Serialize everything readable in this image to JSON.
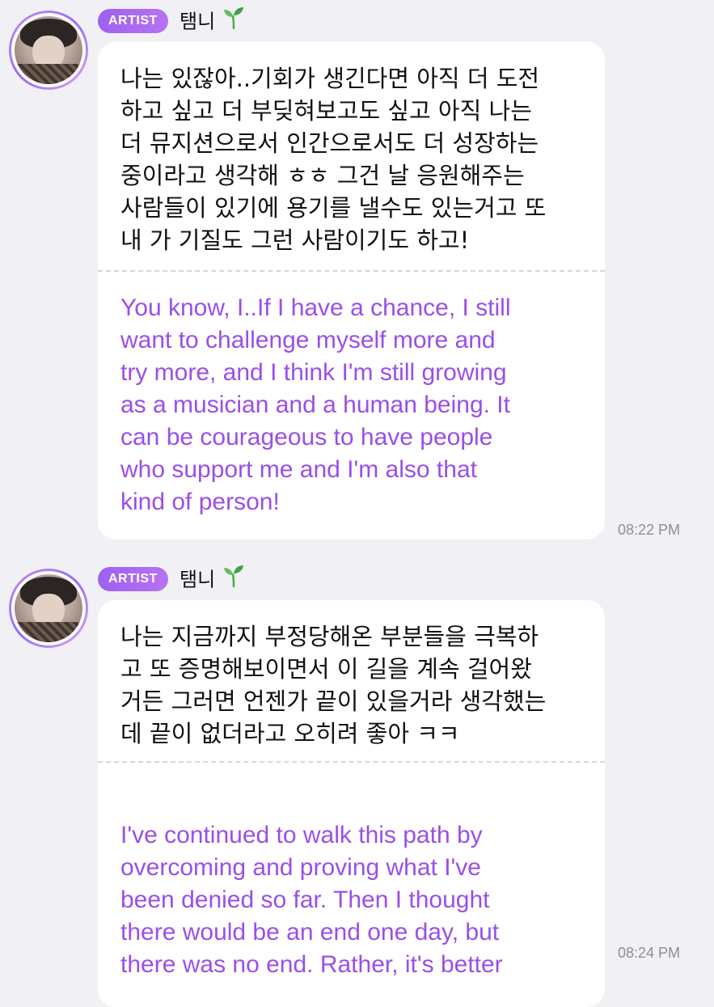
{
  "messages": [
    {
      "badge": "ARTIST",
      "name": "탬니",
      "name_emoji": "sprout-icon",
      "korean": "나는 있잖아..기회가 생긴다면 아직 더 도전\n하고 싶고 더 부딪혀보고도 싶고 아직 나는\n더 뮤지션으로서 인간으로서도 더 성장하는\n중이라고 생각해 ㅎㅎ 그건 날 응원해주는\n사람들이 있기에 용기를 낼수도 있는거고 또\n내 가 기질도 그런 사람이기도 하고!",
      "english": "You know, I..If I have a chance, I still\nwant to challenge myself more and\ntry more, and I think I'm still growing\nas a musician and a human being. It\ncan be courageous to have people\nwho support me and I'm also that\nkind of person!",
      "time": "08:22 PM"
    },
    {
      "badge": "ARTIST",
      "name": "탬니",
      "name_emoji": "sprout-icon",
      "korean": "나는 지금까지 부정당해온 부분들을 극복하\n고 또 증명해보이면서 이 길을 계속 걸어왔\n거든 그러면 언젠가 끝이 있을거라 생각했는\n데 끝이 없더라고 오히려 좋아 ㅋㅋ",
      "english": "I've continued to walk this path by\novercoming and proving what I've\nbeen denied so far. Then I thought\nthere would be an end one day, but\nthere was no end. Rather, it's better",
      "time": "08:24 PM"
    }
  ],
  "colors": {
    "background": "#f1f1f5",
    "bubble": "#ffffff",
    "badge": "#a566f1",
    "translation_text": "#9a4fe6",
    "timestamp": "#8e8e94"
  }
}
